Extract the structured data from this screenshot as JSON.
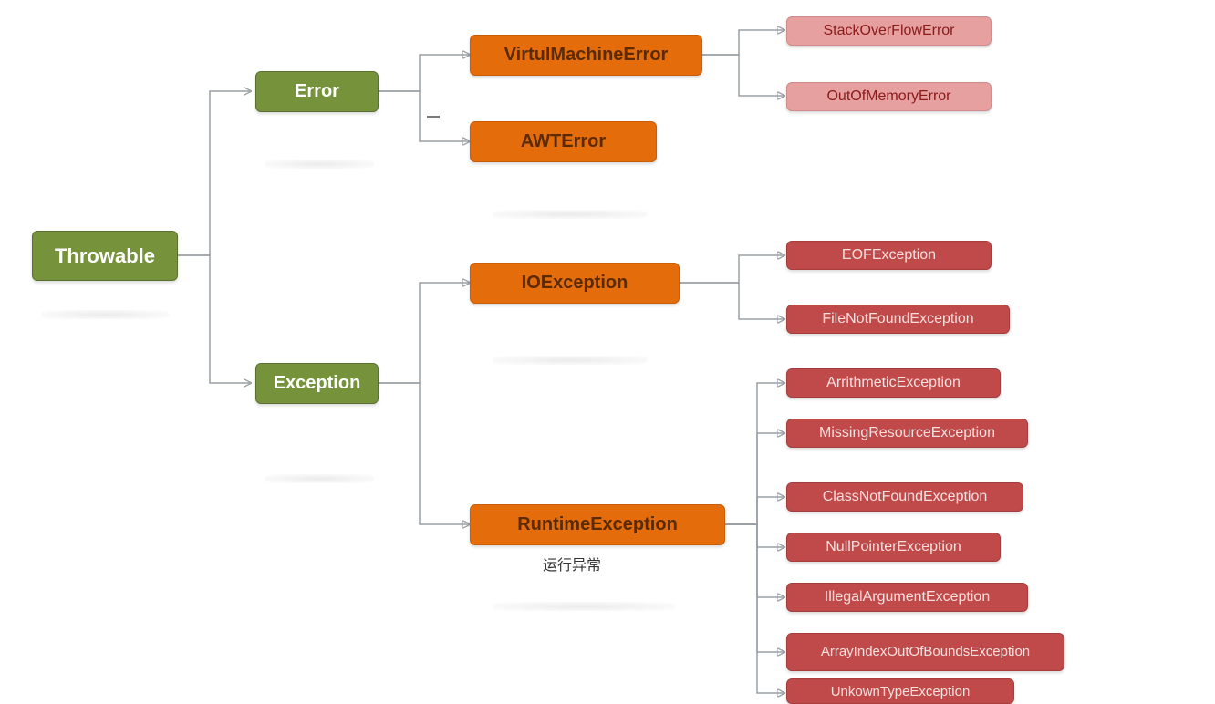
{
  "root": {
    "label": "Throwable"
  },
  "level1": {
    "error": {
      "label": "Error"
    },
    "exception": {
      "label": "Exception"
    }
  },
  "error_children": {
    "vme": {
      "label": "VirtulMachineError"
    },
    "awt": {
      "label": "AWTError"
    }
  },
  "vme_children": {
    "sof": {
      "label": "StackOverFlowError"
    },
    "oom": {
      "label": "OutOfMemoryError"
    }
  },
  "exception_children": {
    "io": {
      "label": "IOException"
    },
    "runtime": {
      "label": "RuntimeException",
      "caption": "运行异常"
    }
  },
  "io_children": {
    "eof": {
      "label": "EOFException"
    },
    "fnf": {
      "label": "FileNotFoundException"
    }
  },
  "runtime_children": {
    "arith": {
      "label": "ArrithmeticException"
    },
    "missres": {
      "label": "MissingResourceException"
    },
    "cnf": {
      "label": "ClassNotFoundException"
    },
    "npe": {
      "label": "NullPointerException"
    },
    "iae": {
      "label": "IllegalArgumentException"
    },
    "aioobe": {
      "label": "ArrayIndexOutOfBoundsException"
    },
    "ute": {
      "label": "UnkownTypeException"
    }
  },
  "colors": {
    "green": "#76933c",
    "orange": "#e46c0a",
    "pink": "#e6a0a0",
    "red": "#c04a4a",
    "connector": "#9aa0a6"
  }
}
